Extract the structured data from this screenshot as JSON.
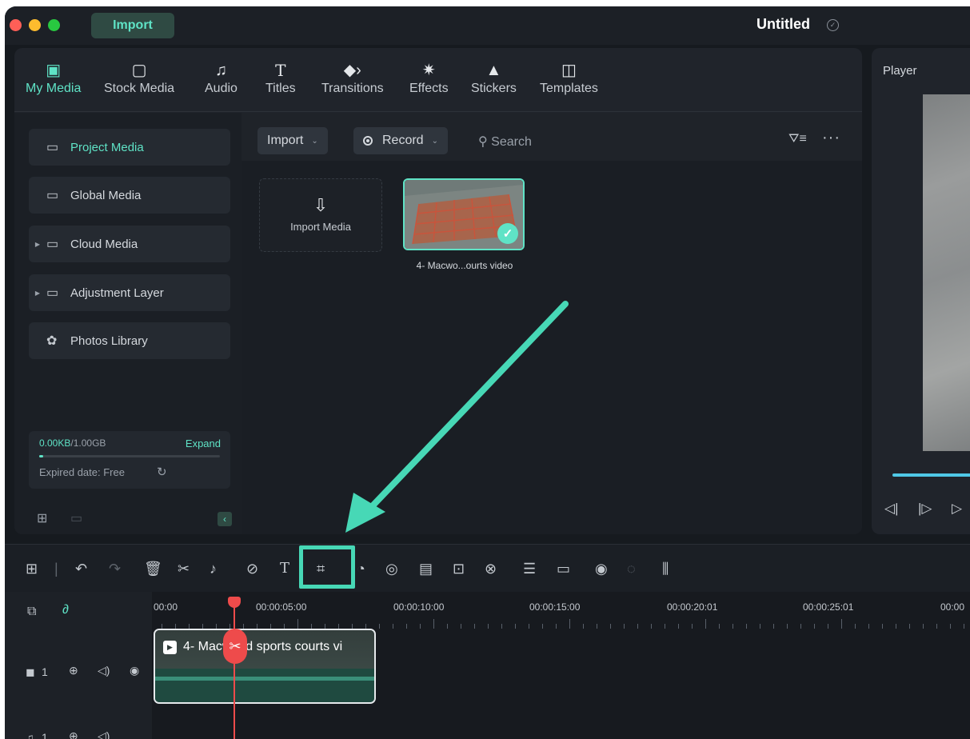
{
  "window": {
    "title": "Untitled",
    "import_tab": "Import"
  },
  "toolbar": {
    "items": [
      {
        "label": "My Media",
        "icon": "my-media-icon"
      },
      {
        "label": "Stock Media",
        "icon": "stock-media-icon"
      },
      {
        "label": "Audio",
        "icon": "music-note-icon"
      },
      {
        "label": "Titles",
        "icon": "text-t-icon"
      },
      {
        "label": "Transitions",
        "icon": "transitions-icon"
      },
      {
        "label": "Effects",
        "icon": "effects-sparkle-icon"
      },
      {
        "label": "Stickers",
        "icon": "stickers-icon"
      },
      {
        "label": "Templates",
        "icon": "templates-icon"
      }
    ]
  },
  "sidebar": {
    "items": [
      {
        "label": "Project Media",
        "active": true
      },
      {
        "label": "Global Media"
      },
      {
        "label": "Cloud Media"
      },
      {
        "label": "Adjustment Layer"
      },
      {
        "label": "Photos Library"
      }
    ],
    "storage": {
      "used": "0.00KB",
      "total": "/1.00GB",
      "expand": "Expand",
      "expired": "Expired date: Free",
      "fraction": 0.0
    }
  },
  "filterbar": {
    "import_label": "Import",
    "record_label": "Record",
    "search_placeholder": "Search"
  },
  "media": {
    "import_card_label": "Import Media",
    "items": [
      {
        "name": "4- Macwo...ourts video",
        "selected": true
      }
    ]
  },
  "player": {
    "title": "Player"
  },
  "timeline": {
    "ruler": [
      "00:00",
      "00:00:05:00",
      "00:00:10:00",
      "00:00:15:00",
      "00:00:20:01",
      "00:00:25:01",
      "00:00"
    ],
    "clip_name": "4- Macwood sports courts vi",
    "video_track": "1",
    "audio_track": "1"
  },
  "colors": {
    "accent": "#5fe3c6",
    "playhead": "#ee4b4b",
    "annotation_arrow": "#47d8b6"
  }
}
